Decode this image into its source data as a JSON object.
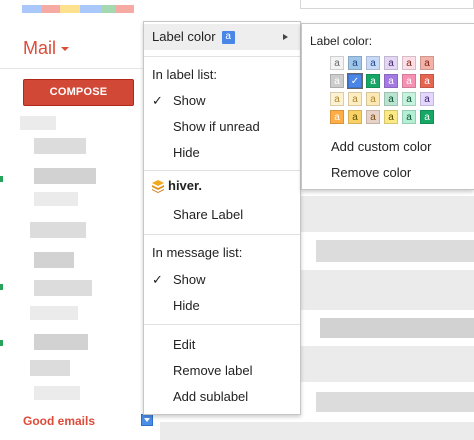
{
  "app": {
    "mail_title": "Mail",
    "compose_label": "COMPOSE",
    "visible_label": "Good emails",
    "logo_colors": [
      "#4285f4",
      "#ea4335",
      "#fbbc05",
      "#4285f4",
      "#34a853",
      "#ea4335"
    ],
    "accent_red": "#dd4b39"
  },
  "menu": {
    "label_color": "Label color",
    "label_color_swatch": "a",
    "label_color_swatch_color": "#4a86e8",
    "in_label_list_header": "In label list:",
    "label_list_options": [
      {
        "label": "Show",
        "checked": true
      },
      {
        "label": "Show if unread",
        "checked": false
      },
      {
        "label": "Hide",
        "checked": false
      }
    ],
    "hiver_brand": "hiver.",
    "share_label": "Share Label",
    "in_message_list_header": "In message list:",
    "message_list_options": [
      {
        "label": "Show",
        "checked": true
      },
      {
        "label": "Hide",
        "checked": false
      }
    ],
    "check_glyph": "✓",
    "edit": "Edit",
    "remove_label": "Remove label",
    "add_sublabel": "Add sublabel"
  },
  "submenu": {
    "header": "Label color:",
    "swatch_letter": "a",
    "selected_glyph": "✓",
    "palette_rows": [
      [
        {
          "bg": "#f3f3f3",
          "fg": "#666666"
        },
        {
          "bg": "#9fc6e7",
          "fg": "#1c4587"
        },
        {
          "bg": "#c9daf8",
          "fg": "#1c4587"
        },
        {
          "bg": "#e4d7f5",
          "fg": "#41236d"
        },
        {
          "bg": "#fcdee8",
          "fg": "#822111"
        },
        {
          "bg": "#f2b2a8",
          "fg": "#822111"
        }
      ],
      [
        {
          "bg": "#cccccc",
          "fg": "#ffffff"
        },
        {
          "bg": "#4a86e8",
          "fg": "#ffffff",
          "selected": true
        },
        {
          "bg": "#16a766",
          "fg": "#ffffff"
        },
        {
          "bg": "#a479e2",
          "fg": "#ffffff"
        },
        {
          "bg": "#f691b3",
          "fg": "#ffffff"
        },
        {
          "bg": "#e66550",
          "fg": "#ffffff"
        }
      ],
      [
        {
          "bg": "#fef1d1",
          "fg": "#aa8831"
        },
        {
          "bg": "#fdedc1",
          "fg": "#aa8831"
        },
        {
          "bg": "#fce8b3",
          "fg": "#aa8831"
        },
        {
          "bg": "#b9e4d0",
          "fg": "#0b4f30"
        },
        {
          "bg": "#c6f3de",
          "fg": "#0b4f30"
        },
        {
          "bg": "#e3d7ff",
          "fg": "#41236d"
        }
      ],
      [
        {
          "bg": "#ffad47",
          "fg": "#ffffff"
        },
        {
          "bg": "#fad165",
          "fg": "#594c05"
        },
        {
          "bg": "#e8d3c8",
          "fg": "#7a4706"
        },
        {
          "bg": "#fbe983",
          "fg": "#594c05"
        },
        {
          "bg": "#b3efd3",
          "fg": "#0b4f30"
        },
        {
          "bg": "#16a765",
          "fg": "#ffffff"
        }
      ]
    ],
    "add_custom_color": "Add custom color",
    "remove_color": "Remove color"
  }
}
